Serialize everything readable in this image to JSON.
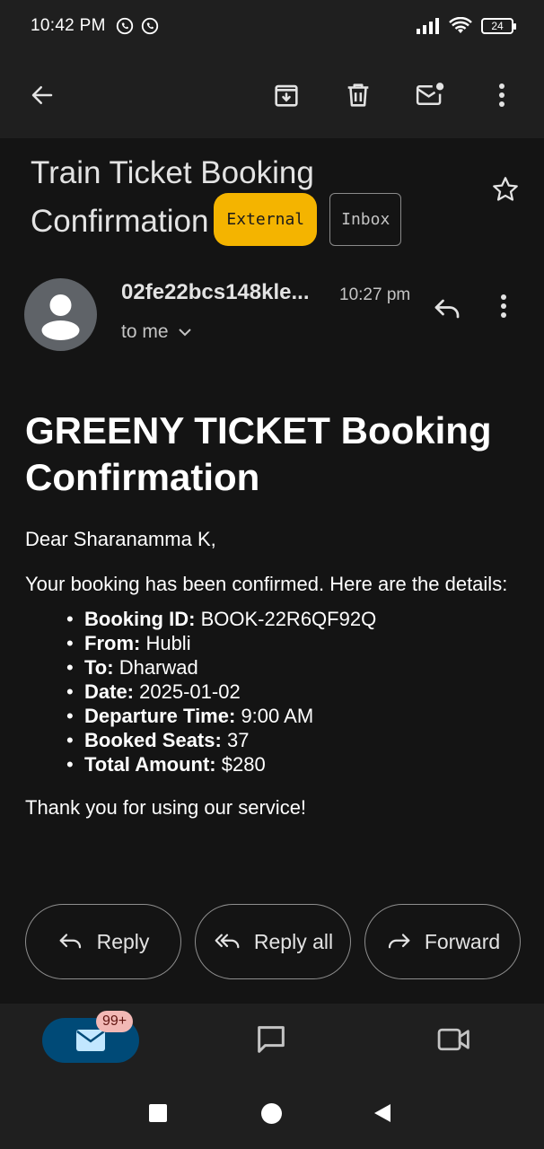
{
  "status_bar": {
    "time": "10:42 PM",
    "battery": "24"
  },
  "toolbar": {
    "back_icon": "arrow-left-icon",
    "archive_icon": "archive-icon",
    "delete_icon": "trash-icon",
    "unread_icon": "mail-unread-icon",
    "more_icon": "more-vert-icon"
  },
  "email": {
    "subject": "Train Ticket Booking Confirmation",
    "labels": {
      "external": "External",
      "inbox": "Inbox"
    },
    "sender": "02fe22bcs148kle...",
    "time": "10:27 pm",
    "recipient": "to me"
  },
  "body": {
    "heading": "GREENY TICKET Booking Confirmation",
    "greeting": "Dear Sharanamma K,",
    "intro": "Your booking has been confirmed. Here are the details:",
    "details": [
      {
        "label": "Booking ID:",
        "value": "BOOK-22R6QF92Q"
      },
      {
        "label": "From:",
        "value": "Hubli"
      },
      {
        "label": "To:",
        "value": "Dharwad"
      },
      {
        "label": "Date:",
        "value": "2025-01-02"
      },
      {
        "label": "Departure Time:",
        "value": "9:00 AM"
      },
      {
        "label": "Booked Seats:",
        "value": "37"
      },
      {
        "label": "Total Amount:",
        "value": "$280"
      }
    ],
    "thanks": "Thank you for using our service!"
  },
  "actions": {
    "reply": "Reply",
    "reply_all": "Reply all",
    "forward": "Forward"
  },
  "bottom_nav": {
    "mail_badge": "99+"
  },
  "colors": {
    "external_badge": "#f4b400",
    "mail_pill": "#004a77",
    "count_badge": "#f2b8b5"
  }
}
